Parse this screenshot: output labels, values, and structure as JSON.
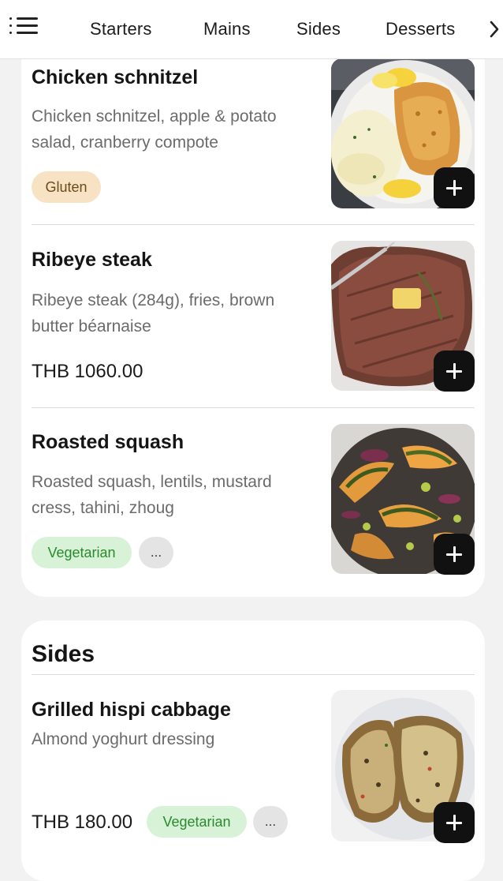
{
  "nav": {
    "tabs": [
      "Starters",
      "Mains",
      "Sides",
      "Desserts"
    ],
    "menu_icon": "list-menu-icon",
    "more_icon": "chevron-right-icon"
  },
  "mains": {
    "items": [
      {
        "name": "Chicken schnitzel",
        "description": "Chicken schnitzel, apple & potato salad, cranberry compote",
        "tags": [
          "Gluten"
        ],
        "add_icon": "plus-icon"
      },
      {
        "name": "Ribeye steak",
        "description": "Ribeye steak (284g), fries, brown butter béarnaise",
        "price": "THB 1060.00",
        "add_icon": "plus-icon"
      },
      {
        "name": "Roasted squash",
        "description": "Roasted squash, lentils, mustard cress, tahini, zhoug",
        "tags": [
          "Vegetarian"
        ],
        "more_tags": "...",
        "add_icon": "plus-icon"
      }
    ]
  },
  "sides": {
    "title": "Sides",
    "items": [
      {
        "name": "Grilled hispi cabbage",
        "description": "Almond yoghurt dressing",
        "price": "THB 180.00",
        "tags": [
          "Vegetarian"
        ],
        "more_tags": "...",
        "add_icon": "plus-icon"
      }
    ]
  },
  "colors": {
    "gluten_tag_bg": "#f7e2c4",
    "vegetarian_tag_bg": "#d7f2d6",
    "vegetarian_tag_text": "#2a8a2e",
    "add_button": "#111111",
    "page_bg": "#f2f2f2"
  }
}
